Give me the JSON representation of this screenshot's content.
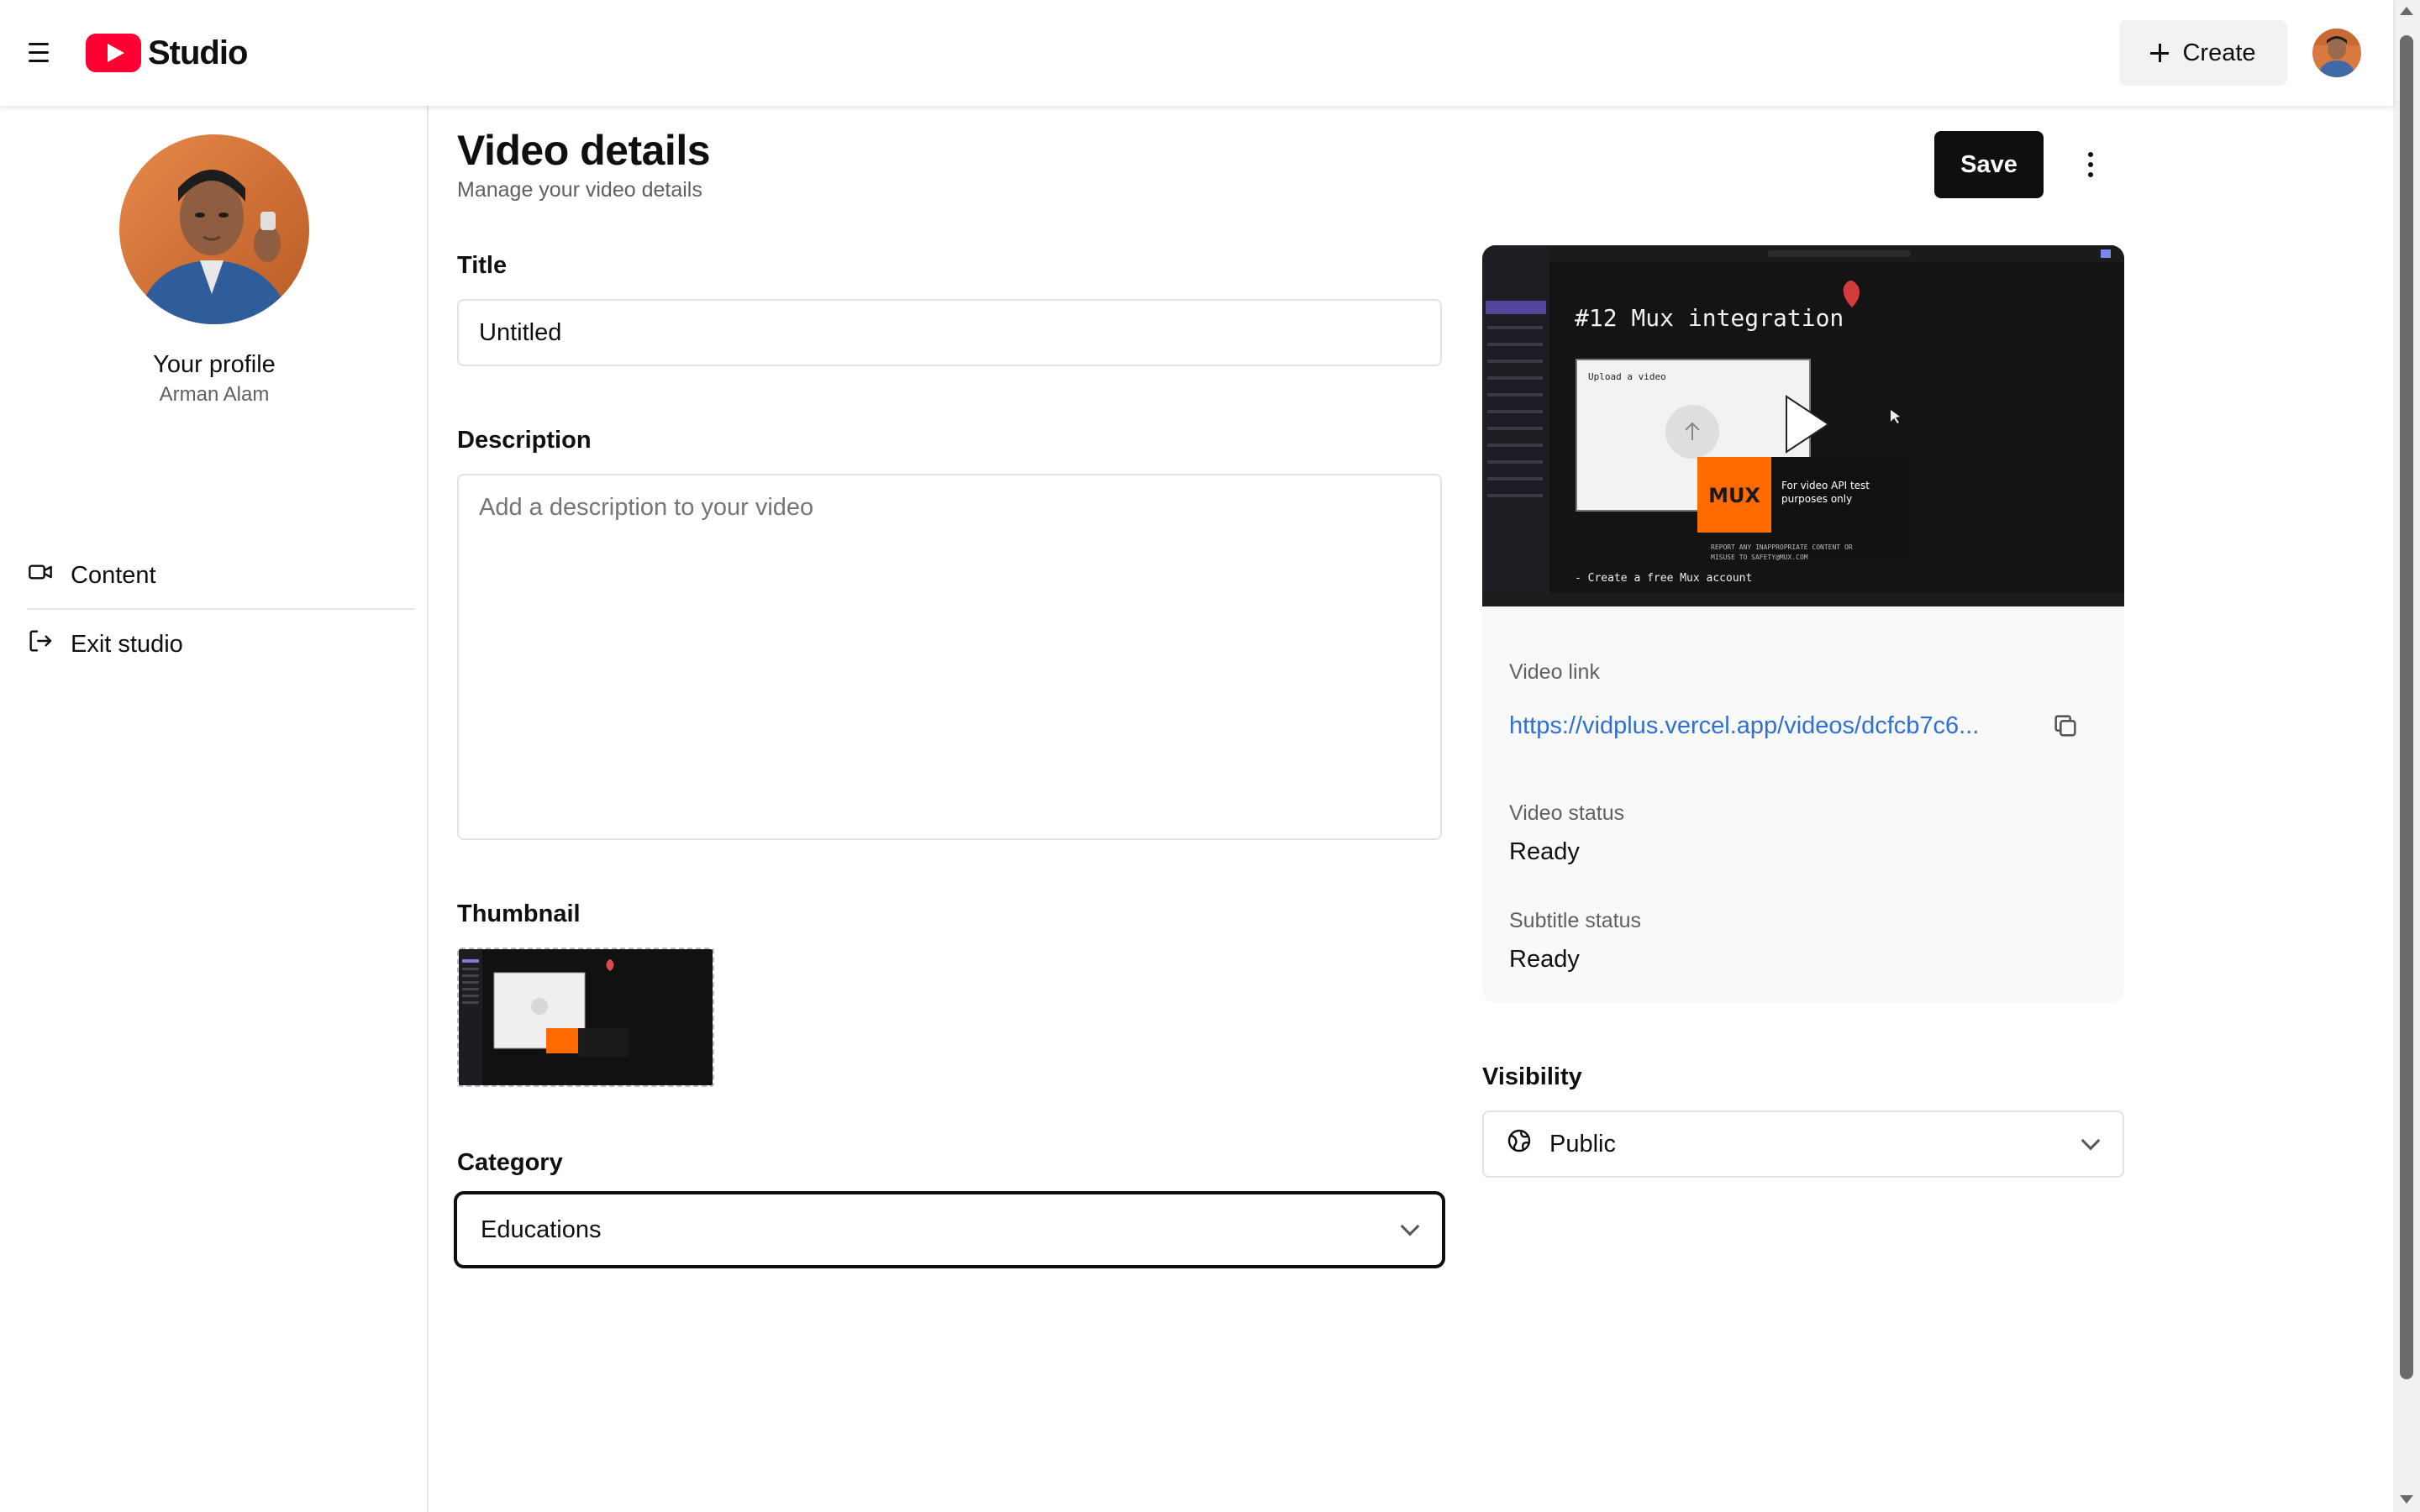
{
  "header": {
    "app_name": "Studio",
    "create_label": "Create",
    "brand_color": "#ff0033"
  },
  "sidebar": {
    "profile_title": "Your profile",
    "profile_name": "Arman Alam",
    "items": [
      {
        "label": "Content",
        "icon": "video-camera-icon"
      },
      {
        "label": "Exit studio",
        "icon": "logout-icon"
      }
    ]
  },
  "page": {
    "title": "Video details",
    "subtitle": "Manage your video details",
    "save_label": "Save"
  },
  "form": {
    "title_label": "Title",
    "title_value": "Untitled",
    "description_label": "Description",
    "description_placeholder": "Add a description to your video",
    "thumbnail_label": "Thumbnail",
    "category_label": "Category",
    "category_value": "Educations",
    "visibility_label": "Visibility",
    "visibility_value": "Public"
  },
  "player": {
    "overlay_title": "#12 Mux integration",
    "dialog_title": "Upload a video",
    "mux_logo": "MUX",
    "mux_caption": "For video API test purposes only",
    "mux_report": "REPORT ANY INAPPROPRIATE CONTENT OR MISUSE TO SAFETY@MUX.COM",
    "bullet": "- Create a free Mux account"
  },
  "info": {
    "video_link_label": "Video link",
    "video_link": "https://vidplus.vercel.app/videos/dcfcb7c6...",
    "video_status_label": "Video status",
    "video_status": "Ready",
    "subtitle_status_label": "Subtitle status",
    "subtitle_status": "Ready",
    "link_color": "#2f6fd6"
  }
}
